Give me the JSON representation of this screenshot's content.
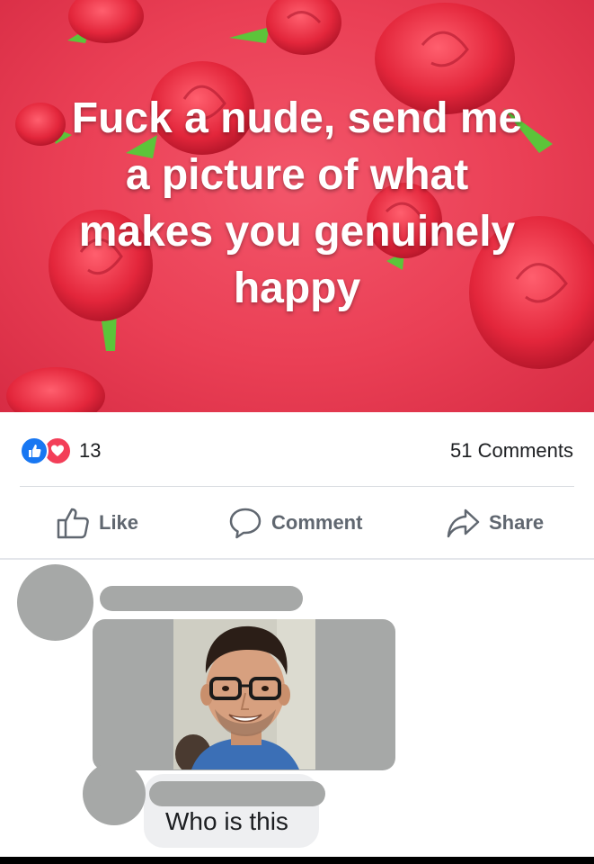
{
  "post": {
    "quote_lines": [
      "Fuck a nude, send me",
      "a picture of what",
      "makes you genuinely",
      "happy"
    ]
  },
  "stats": {
    "reaction_count": "13",
    "reaction_icons": [
      "like-icon",
      "love-icon"
    ],
    "comments_label": "51 Comments"
  },
  "actions": {
    "like_label": "Like",
    "comment_label": "Comment",
    "share_label": "Share"
  },
  "comments": {
    "reply_text": "Who is this"
  },
  "colors": {
    "post_background": "#ea3f55",
    "like_blue": "#1877f2",
    "love_red": "#f33e58",
    "redaction_gray": "#a6a8a7"
  }
}
